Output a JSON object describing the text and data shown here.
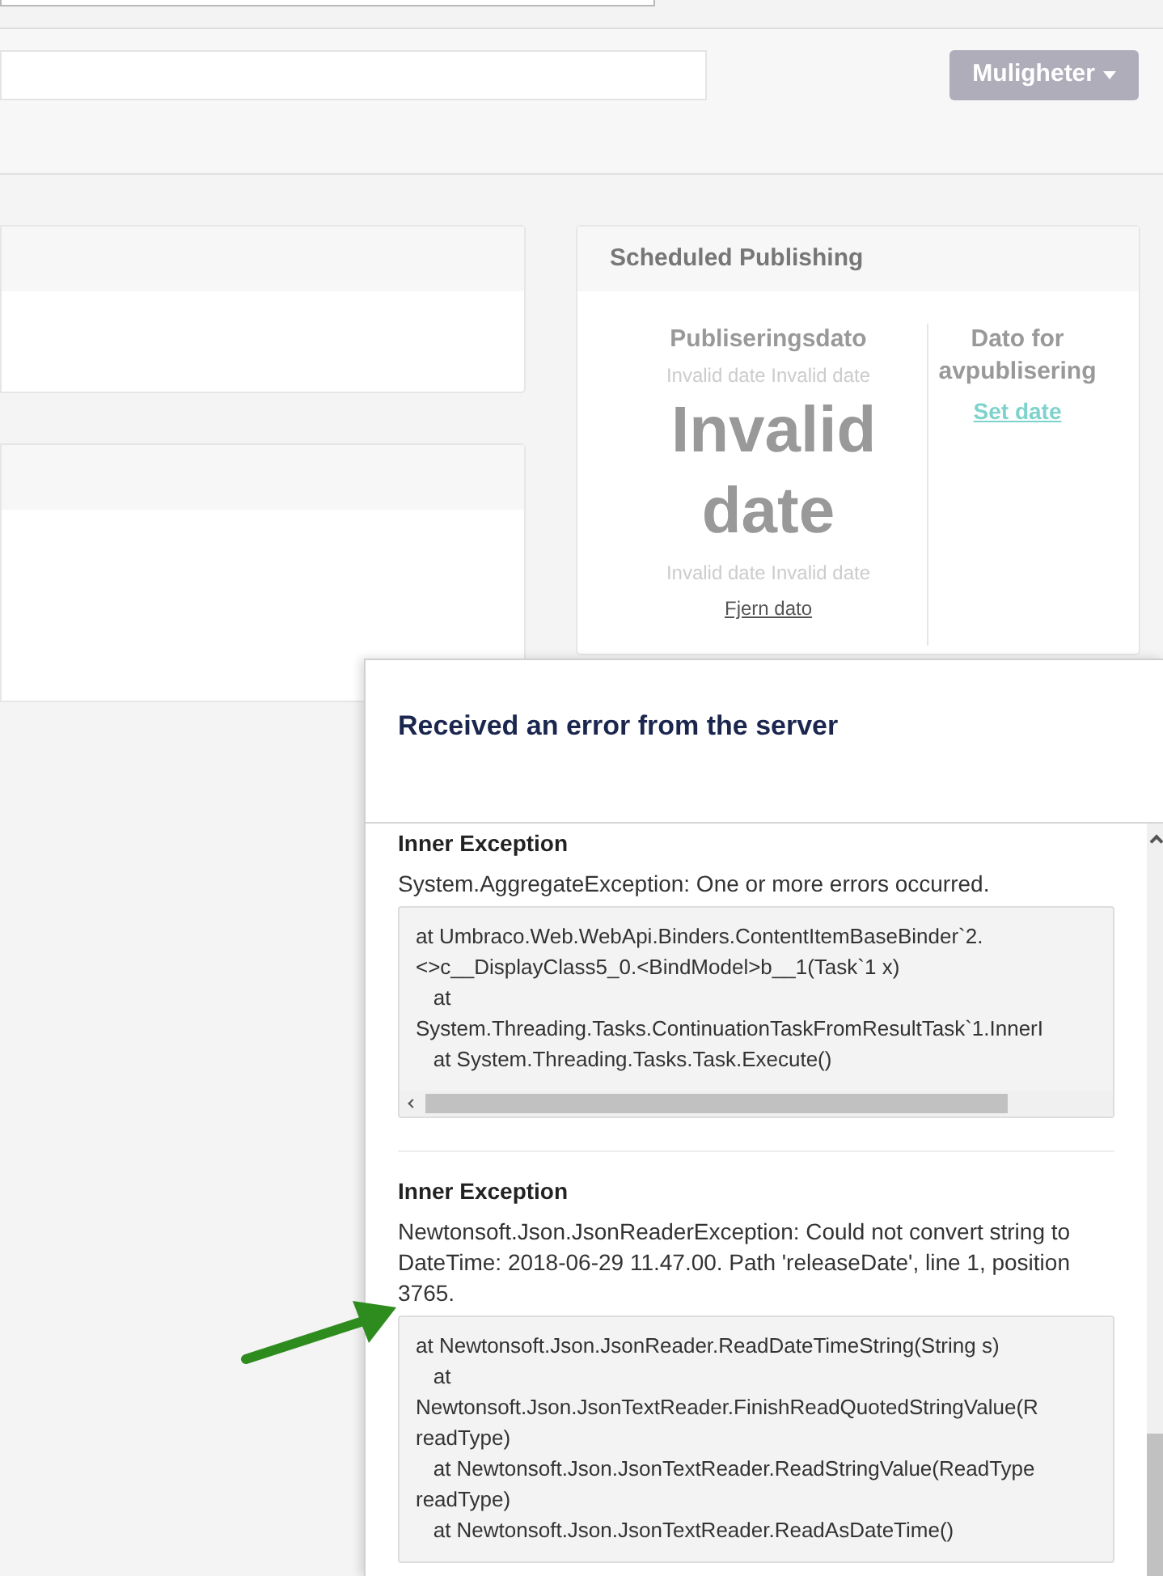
{
  "header": {
    "options_button": "Muligheter"
  },
  "scheduled_publishing": {
    "title": "Scheduled Publishing",
    "publish": {
      "label": "Publiseringsdato",
      "sub_top": "Invalid date Invalid date",
      "big": "Invalid date",
      "sub_bottom": "Invalid date Invalid date",
      "remove_link": "Fjern dato"
    },
    "unpublish": {
      "label": "Dato for avpublisering",
      "set_link": "Set date"
    }
  },
  "error_dialog": {
    "title": "Received an error from the server",
    "exceptions": [
      {
        "heading": "Inner Exception",
        "message": "System.AggregateException: One or more errors occurred.",
        "stack": [
          "at Umbraco.Web.WebApi.Binders.ContentItemBaseBinder`2.",
          "<>c__DisplayClass5_0.<BindModel>b__1(Task`1 x)",
          "   at",
          "System.Threading.Tasks.ContinuationTaskFromResultTask`1.InnerI",
          "   at System.Threading.Tasks.Task.Execute()"
        ],
        "horizontal_scrollbar": true,
        "pointer_arrow": false
      },
      {
        "heading": "Inner Exception",
        "message": "Newtonsoft.Json.JsonReaderException: Could not convert string to DateTime: 2018-06-29 11.47.00. Path 'releaseDate', line 1, position 3765.",
        "stack": [
          "at Newtonsoft.Json.JsonReader.ReadDateTimeString(String s)",
          "   at",
          "Newtonsoft.Json.JsonTextReader.FinishReadQuotedStringValue(R",
          "readType)",
          "   at Newtonsoft.Json.JsonTextReader.ReadStringValue(ReadType",
          "readType)",
          "   at Newtonsoft.Json.JsonTextReader.ReadAsDateTime()"
        ],
        "horizontal_scrollbar": false,
        "pointer_arrow": true
      }
    ]
  }
}
